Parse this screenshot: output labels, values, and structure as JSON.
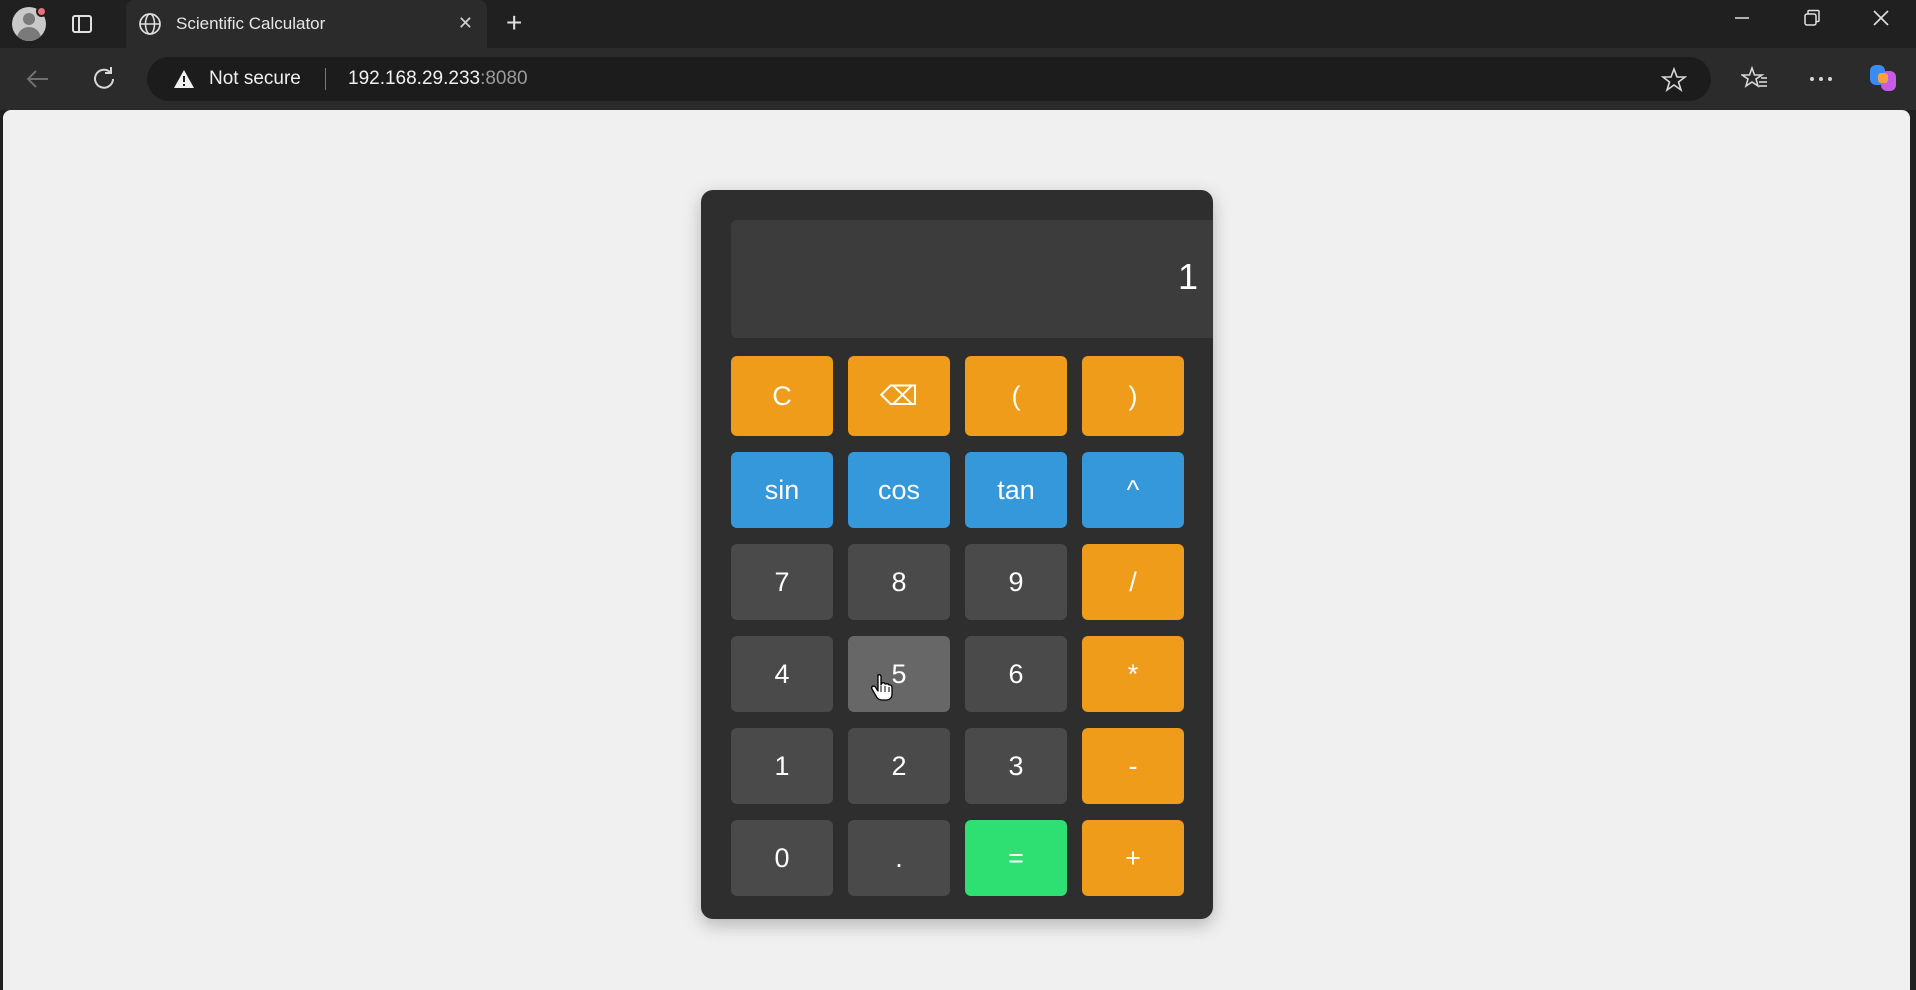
{
  "browser": {
    "tab_title": "Scientific Calculator",
    "security_label": "Not secure",
    "url_host": "192.168.29.233",
    "url_port": ":8080"
  },
  "calculator": {
    "display": "1",
    "rows": [
      [
        {
          "label": "C",
          "style": "orange"
        },
        {
          "label": "⌫",
          "style": "orange"
        },
        {
          "label": "(",
          "style": "orange"
        },
        {
          "label": ")",
          "style": "orange"
        }
      ],
      [
        {
          "label": "sin",
          "style": "blue"
        },
        {
          "label": "cos",
          "style": "blue"
        },
        {
          "label": "tan",
          "style": "blue"
        },
        {
          "label": "^",
          "style": "blue"
        }
      ],
      [
        {
          "label": "7",
          "style": "gray"
        },
        {
          "label": "8",
          "style": "gray"
        },
        {
          "label": "9",
          "style": "gray"
        },
        {
          "label": "/",
          "style": "orange"
        }
      ],
      [
        {
          "label": "4",
          "style": "gray"
        },
        {
          "label": "5",
          "style": "gray-hover"
        },
        {
          "label": "6",
          "style": "gray"
        },
        {
          "label": "*",
          "style": "orange"
        }
      ],
      [
        {
          "label": "1",
          "style": "gray"
        },
        {
          "label": "2",
          "style": "gray"
        },
        {
          "label": "3",
          "style": "gray"
        },
        {
          "label": "-",
          "style": "orange"
        }
      ],
      [
        {
          "label": "0",
          "style": "gray"
        },
        {
          "label": ".",
          "style": "gray"
        },
        {
          "label": "=",
          "style": "green"
        },
        {
          "label": "+",
          "style": "orange"
        }
      ]
    ]
  },
  "colors": {
    "orange": "#f09c1b",
    "blue": "#3498db",
    "gray": "#4a4a4a",
    "green": "#2ee071",
    "calc_body": "#2e2e2e",
    "page_bg": "#f0f0f0"
  }
}
